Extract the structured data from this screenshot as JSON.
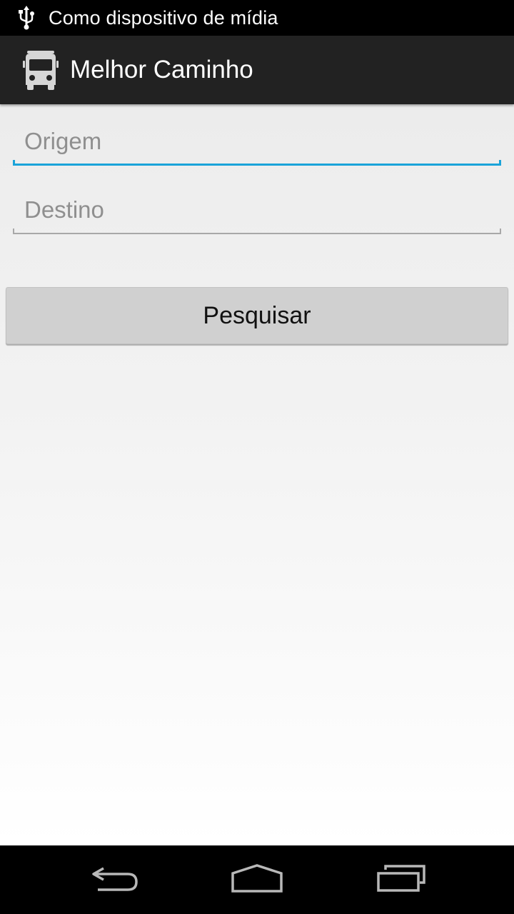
{
  "status_bar": {
    "notification_text": "Como dispositivo de mídia",
    "icon": "usb-icon"
  },
  "action_bar": {
    "title": "Melhor Caminho",
    "icon": "bus-icon"
  },
  "form": {
    "origin": {
      "placeholder": "Origem",
      "value": "",
      "focused": true
    },
    "destination": {
      "placeholder": "Destino",
      "value": ""
    },
    "search_label": "Pesquisar"
  },
  "nav_bar": {
    "back_icon": "back-icon",
    "home_icon": "home-icon",
    "recents_icon": "recents-icon"
  },
  "colors": {
    "accent": "#1aa3d9",
    "action_bar_bg": "#222222",
    "button_bg": "#d0d0d0"
  }
}
